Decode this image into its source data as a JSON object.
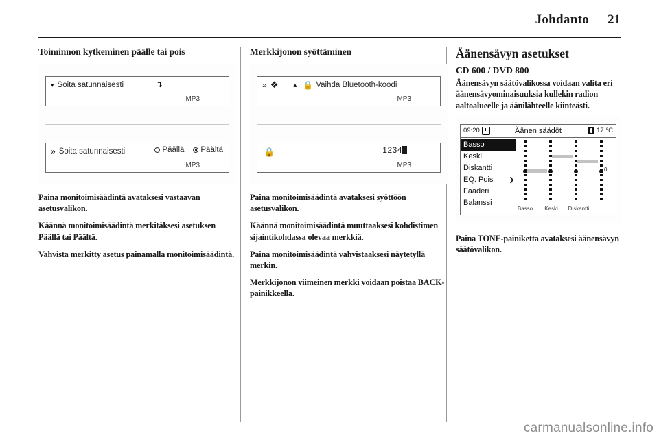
{
  "header": {
    "title": "Johdanto",
    "page_number": "21"
  },
  "columns": [
    {
      "heading": "Toiminnon kytkeminen päälle tai pois",
      "figure": {
        "type": "infotainment-menu",
        "row_top": {
          "caret_icon": "caret-down-icon",
          "label": "Soita satunnaisesti",
          "enter_icon": "enter-arrow-icon",
          "format_label": "MP3"
        },
        "row_bottom": {
          "ff_icon": "fast-forward-icon",
          "label": "Soita satunnaisesti",
          "options": [
            {
              "label": "Päällä",
              "selected": false
            },
            {
              "label": "Päältä",
              "selected": true
            }
          ],
          "format_label": "MP3"
        }
      },
      "paragraphs": [
        "Paina monitoimisäädintä avataksesi vastaavan asetusvalikon.",
        "Käännä monitoimisäädintä merkitäksesi asetuksen Päällä tai Päältä.",
        "Vahvista merkitty asetus painamalla monitoimisäädintä."
      ]
    },
    {
      "heading": "Merkkijonon syöttäminen",
      "figure": {
        "type": "infotainment-menu",
        "row_top": {
          "ff_icon": "fast-forward-icon",
          "bt_icon": "bluetooth-icon",
          "up_icon": "caret-up-icon",
          "lock_icon": "lock-icon",
          "label": "Vaihda Bluetooth-koodi",
          "format_label": "MP3"
        },
        "row_bottom": {
          "lock_icon": "lock-icon",
          "value": "1234",
          "cursor": "text-cursor-block",
          "format_label": "MP3"
        }
      },
      "paragraphs": [
        "Paina monitoimisäädintä avataksesi syöttöön asetusvalikon.",
        "Käännä monitoimisäädintä muuttaaksesi kohdistimen sijaintikohdassa olevaa merkkiä.",
        "Paina monitoimisäädintä vahvistaaksesi näytetyllä merkin.",
        "Merkkijonon viimeinen merkki voidaan poistaa BACK-painikkeella."
      ]
    },
    {
      "heading": "Äänensävyn asetukset",
      "model_label": "CD 600 / DVD 800",
      "intro": "Äänensävyn säätövalikossa voidaan valita eri äänensävyominaisuuksia kullekin radion aaltoalueelle ja äänilähteelle kiinteästi.",
      "figure": {
        "type": "tone-settings-screen",
        "status": {
          "time": "09:20",
          "clock_icon": "clock-icon",
          "title": "Äänen säädöt",
          "thermo_icon": "thermometer-icon",
          "temperature": "17 °C"
        },
        "list": [
          {
            "label": "Basso",
            "selected": true,
            "arrow": false
          },
          {
            "label": "Keski",
            "selected": false,
            "arrow": false
          },
          {
            "label": "Diskantti",
            "selected": false,
            "arrow": false
          },
          {
            "label": "EQ:  Pois",
            "selected": false,
            "arrow": true
          },
          {
            "label": "Faaderi",
            "selected": false,
            "arrow": false
          },
          {
            "label": "Balanssi",
            "selected": false,
            "arrow": false
          }
        ],
        "sliders": [
          {
            "label": "Basso",
            "value": 0
          },
          {
            "label": "Keski",
            "value": 3
          },
          {
            "label": "Diskantti",
            "value": 2
          }
        ],
        "axis_zero_label": "0"
      },
      "paragraphs": [
        "Paina TONE-painiketta avataksesi äänensävyn säätövalikon."
      ]
    }
  ],
  "footer": {
    "watermark": "carmanualsonline.info"
  }
}
